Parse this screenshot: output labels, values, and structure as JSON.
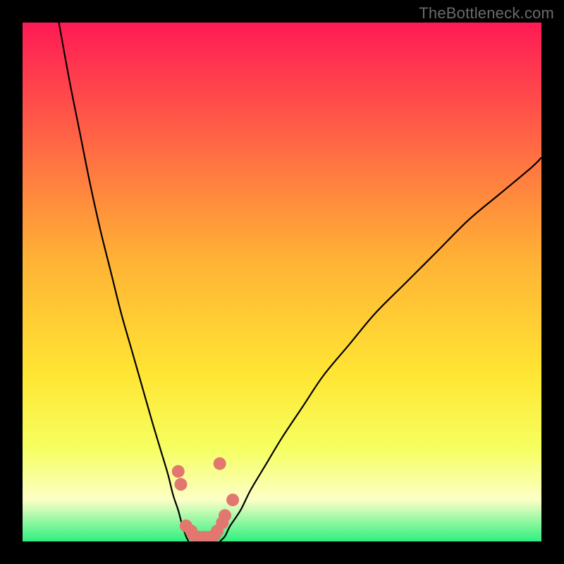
{
  "watermark": "TheBottleneck.com",
  "colors": {
    "frame": "#000000",
    "curve": "#000000",
    "points": "#e27770",
    "gradient_top": "#ff1a55",
    "gradient_mid1": "#ffb035",
    "gradient_mid2": "#ffe634",
    "gradient_mid3": "#f6ff60",
    "gradient_mid4": "#fcffc6",
    "gradient_bottom": "#2ef07f"
  },
  "chart_data": {
    "type": "line",
    "title": "",
    "xlabel": "",
    "ylabel": "",
    "xlim": [
      0,
      100
    ],
    "ylim": [
      0,
      100
    ],
    "series": [
      {
        "name": "left-curve",
        "x": [
          7,
          9,
          11,
          13,
          15,
          17,
          19,
          21,
          23,
          25,
          26.5,
          28,
          29,
          30,
          30.8,
          31.5,
          32
        ],
        "y": [
          100,
          89,
          79,
          69,
          60,
          52,
          44,
          37,
          30,
          23,
          18,
          13,
          9,
          6,
          3,
          1,
          0
        ]
      },
      {
        "name": "right-curve",
        "x": [
          38,
          39,
          40,
          42,
          44,
          47,
          50,
          54,
          58,
          63,
          68,
          74,
          80,
          86,
          92,
          98,
          100
        ],
        "y": [
          0,
          1,
          3,
          6,
          10,
          15,
          20,
          26,
          32,
          38,
          44,
          50,
          56,
          62,
          67,
          72,
          74
        ]
      }
    ],
    "scatter_points": {
      "name": "marked-points",
      "x": [
        30,
        30.5,
        31.5,
        32.5,
        33,
        34,
        35,
        36,
        37,
        37.5,
        38.5,
        39,
        40.5,
        38
      ],
      "y": [
        13.5,
        11,
        3,
        2,
        1.2,
        0.8,
        0.8,
        0.8,
        1.2,
        2,
        3.6,
        5,
        8,
        15
      ]
    },
    "legend": null,
    "grid": false
  }
}
